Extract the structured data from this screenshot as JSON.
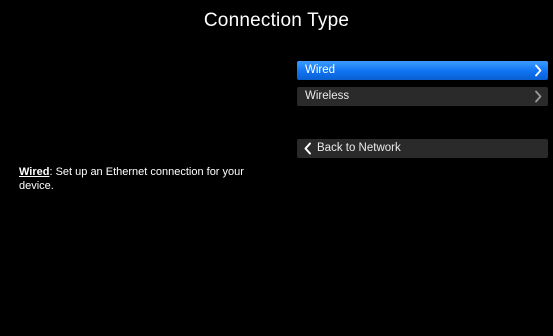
{
  "header": {
    "title": "Connection Type"
  },
  "menu": {
    "items": [
      {
        "label": "Wired",
        "selected": true,
        "icon": "chevron-right-icon"
      },
      {
        "label": "Wireless",
        "selected": false,
        "icon": "chevron-right-icon"
      }
    ],
    "back": {
      "label": "Back to Network",
      "icon": "chevron-left-icon"
    }
  },
  "description": {
    "term": "Wired",
    "text": ": Set up an Ethernet connection for your device."
  },
  "colors": {
    "background": "#000000",
    "selected": "#1479f5",
    "item": "#2a2a2a",
    "text": "#ffffff"
  }
}
